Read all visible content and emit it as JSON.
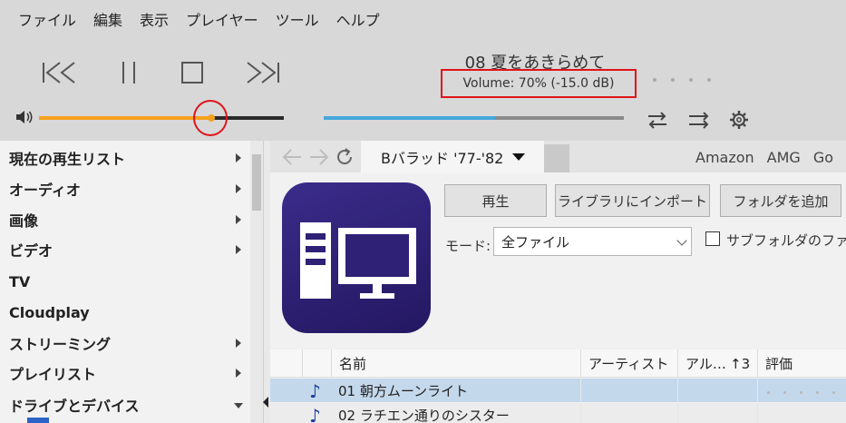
{
  "menu": [
    "ファイル",
    "編集",
    "表示",
    "プレイヤー",
    "ツール",
    "ヘルプ"
  ],
  "player": {
    "track_title": "08 夏をあきらめて",
    "volume_text": "Volume: 70%  (-15.0 dB)",
    "volume_level": 0.7,
    "seek_progress": 0.57
  },
  "sidebar": {
    "items": [
      {
        "label": "現在の再生リスト",
        "arrow": "right"
      },
      {
        "label": "オーディオ",
        "arrow": "right"
      },
      {
        "label": "画像",
        "arrow": "right"
      },
      {
        "label": "ビデオ",
        "arrow": "right"
      },
      {
        "label": "TV",
        "arrow": ""
      },
      {
        "label": "Cloudplay",
        "arrow": ""
      },
      {
        "label": "ストリーミング",
        "arrow": "right"
      },
      {
        "label": "プレイリスト",
        "arrow": "right"
      },
      {
        "label": "ドライブとデバイス",
        "arrow": "down"
      }
    ]
  },
  "tabs": {
    "active": "Bバラッド '77-'82",
    "links": [
      "Amazon",
      "AMG",
      "Go"
    ]
  },
  "toolbar": {
    "play_label": "再生",
    "import_label": "ライブラリにインポート",
    "add_folder_label": "フォルダを追加",
    "mode_label": "モード:",
    "mode_value": "全ファイル",
    "subfolder_label": "サブフォルダのファイ"
  },
  "table": {
    "headers": [
      "名前",
      "アーティスト",
      "アル…",
      "↑3",
      "評価"
    ],
    "rows": [
      {
        "name": "01 朝方ムーンライト",
        "selected": true
      },
      {
        "name": "02 ラチエン通りのシスター",
        "selected": false
      }
    ]
  },
  "colors": {
    "volume_fill": "#f6a11d",
    "seek_fill": "#46a7dc",
    "highlight": "#e0141b",
    "selected_row": "#c4d8ec",
    "app_icon": "#2e2176"
  },
  "icons": [
    "previous-icon",
    "pause-icon",
    "stop-icon",
    "next-icon",
    "speaker-icon",
    "repeat-icon",
    "shuffle-icon",
    "gear-icon",
    "back-arrow-icon",
    "forward-arrow-icon",
    "refresh-icon",
    "computer-icon",
    "music-note-icon"
  ]
}
